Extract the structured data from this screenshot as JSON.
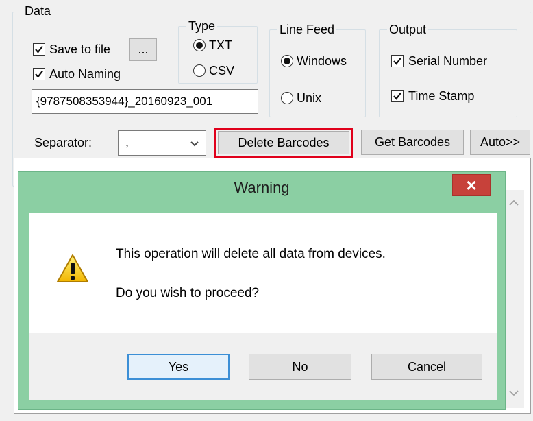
{
  "data_group": {
    "title": "Data"
  },
  "save_to_file": {
    "label": "Save to file",
    "checked": true,
    "browse_label": "..."
  },
  "auto_naming": {
    "label": "Auto Naming",
    "checked": true
  },
  "filename": {
    "value": "{9787508353944}_20160923_001"
  },
  "type_group": {
    "title": "Type",
    "options": [
      "TXT",
      "CSV"
    ],
    "selected": "TXT"
  },
  "line_feed_group": {
    "title": "Line Feed",
    "options": [
      "Windows",
      "Unix"
    ],
    "selected": "Windows"
  },
  "output_group": {
    "title": "Output",
    "serial_number_label": "Serial Number",
    "time_stamp_label": "Time Stamp"
  },
  "separator": {
    "label": "Separator:",
    "value": ","
  },
  "toolbar": {
    "delete_barcodes_label": "Delete Barcodes",
    "get_barcodes_label": "Get Barcodes",
    "auto_label": "Auto>>"
  },
  "highlight_color": "#e0001b",
  "dialog": {
    "title": "Warning",
    "close_glyph": "×",
    "icon": "warning-icon",
    "message_line1": "This operation will delete all data from devices.",
    "message_line2": "Do you wish to proceed?",
    "yes_label": "Yes",
    "no_label": "No",
    "cancel_label": "Cancel"
  },
  "scrollbar": {
    "up_icon": "chevron-up-icon",
    "down_icon": "chevron-down-icon"
  }
}
